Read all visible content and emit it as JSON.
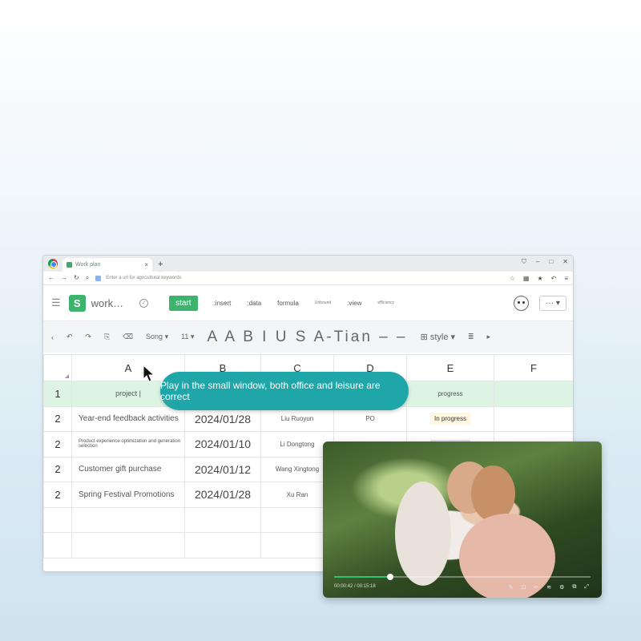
{
  "browser": {
    "tab_title": "Work plan",
    "new_tab": "+",
    "url_placeholder": "Enter a url for agricultural keywords"
  },
  "app": {
    "logo": "S",
    "title": "work…",
    "menu": {
      "start": "start",
      "insert": ":insert",
      "data": ":data",
      "formula": "formula",
      "tab5": "Unbound",
      "view": ":view",
      "efficiency": "efficiency"
    },
    "more": "···"
  },
  "toolbar": {
    "font": "Song",
    "size": "11",
    "format": "A A B I U S A-Tian – –",
    "style": "style"
  },
  "sheet": {
    "columns": [
      "A",
      "B",
      "C",
      "D",
      "E",
      "F"
    ],
    "header_row": {
      "num": "1",
      "a": "project",
      "e": "progress"
    },
    "rows": [
      {
        "num": "2",
        "project": "Year-end feedback activities",
        "date": "2024/01/28",
        "owner": "Liu Ruoyun",
        "d": "PO",
        "status": "In progress"
      },
      {
        "num": "2",
        "project": "Product experience optimization and generation selection",
        "date": "2024/01/10",
        "owner": "Li Dongtong",
        "d": "",
        "status": ""
      },
      {
        "num": "2",
        "project": "Customer gift purchase",
        "date": "2024/01/12",
        "owner": "Wang Xingtong",
        "d": "",
        "status": ""
      },
      {
        "num": "2",
        "project": "Spring Festival Promotions",
        "date": "2024/01/28",
        "owner": "Xu Ran",
        "d": "",
        "status": ""
      }
    ]
  },
  "tooltip": "Play in the small window, both office and leisure are correct",
  "video": {
    "time": "00:00:42 / 00:15:18",
    "progress": 0.2
  },
  "colors": {
    "accent": "#3db46d",
    "tooltip": "#1fa6a8",
    "highlight_row": "#ddf3e3"
  }
}
